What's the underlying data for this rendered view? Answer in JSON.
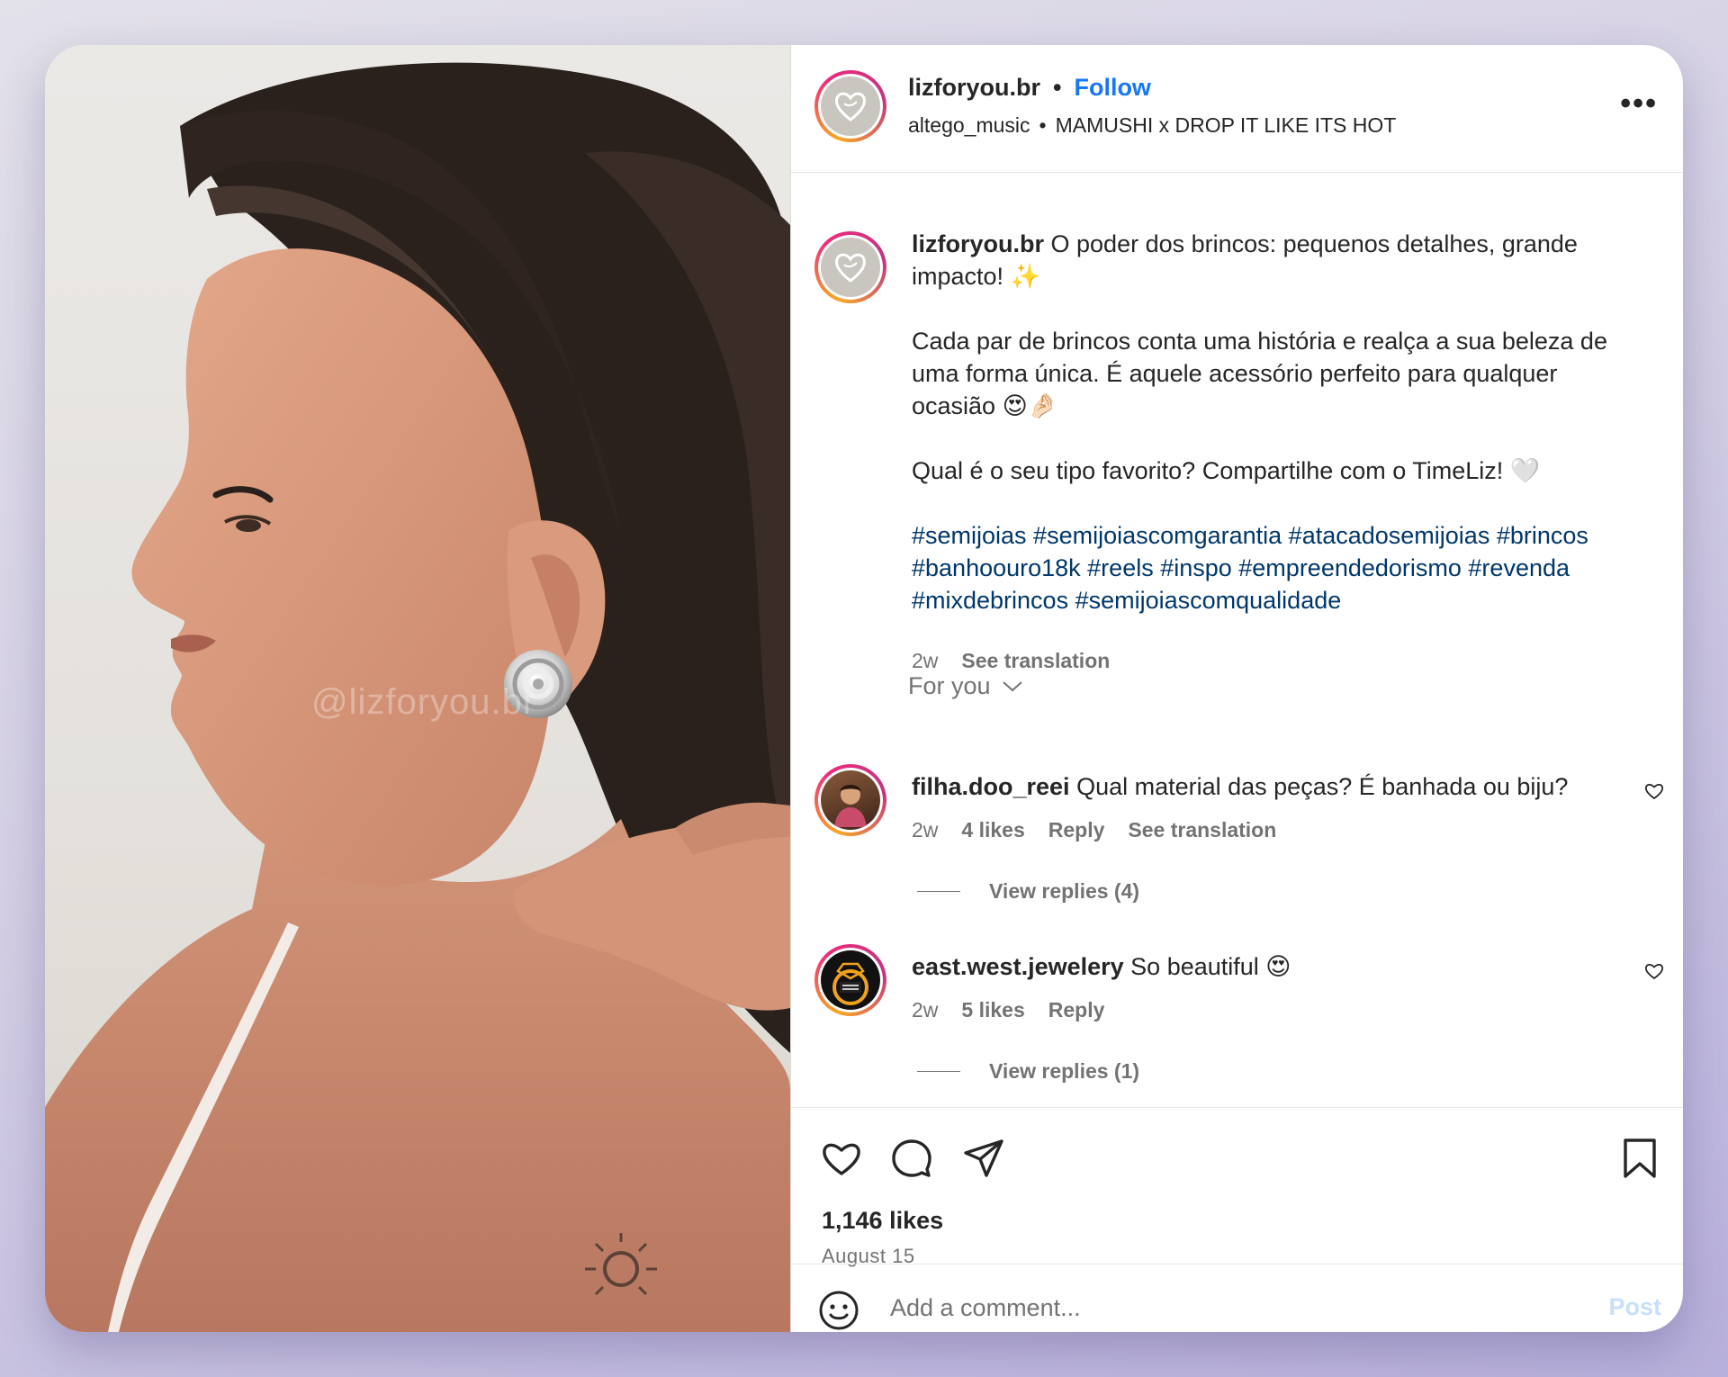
{
  "post": {
    "username": "lizforyou.br",
    "follow_label": "Follow",
    "separator": "•",
    "audio_artist": "altego_music",
    "audio_title": "MAMUSHI x DROP IT LIKE ITS HOT",
    "more_label": "•••",
    "watermark": "@lizforyou.br"
  },
  "caption": {
    "username": "lizforyou.br",
    "line1": "O poder dos brincos: pequenos detalhes, grande impacto! ✨",
    "paragraph2": "Cada par de brincos conta uma história e realça a sua beleza de uma forma única. É aquele acessório perfeito para qualquer ocasião 😍🤌🏻",
    "paragraph3": "Qual é o seu tipo favorito? Compartilhe com o TimeLiz! 🤍",
    "hashtags": "#semijoias #semijoiascomgarantia #atacadosemijoias #brincos #banhoouro18k #reels #inspo #empreendedorismo #revenda #mixdebrincos #semijoiascomqualidade",
    "time": "2w",
    "see_translation": "See translation"
  },
  "filter": {
    "label": "For you"
  },
  "comments": [
    {
      "username": "filha.doo_reei",
      "text": "Qual material das peças? É banhada ou biju?",
      "time": "2w",
      "likes": "4 likes",
      "reply": "Reply",
      "see_translation": "See translation",
      "view_replies": "View replies (4)"
    },
    {
      "username": "east.west.jewelery",
      "text": "So beautiful 😍",
      "time": "2w",
      "likes": "5 likes",
      "reply": "Reply",
      "view_replies": "View replies (1)"
    }
  ],
  "stats": {
    "likes": "1,146 likes",
    "date": "August 15"
  },
  "composer": {
    "placeholder": "Add a comment...",
    "post_label": "Post"
  },
  "colors": {
    "link_blue": "#1877f2",
    "hashtag_blue": "#00376b",
    "secondary_text": "#737373",
    "post_disabled": "#c7dffb"
  }
}
